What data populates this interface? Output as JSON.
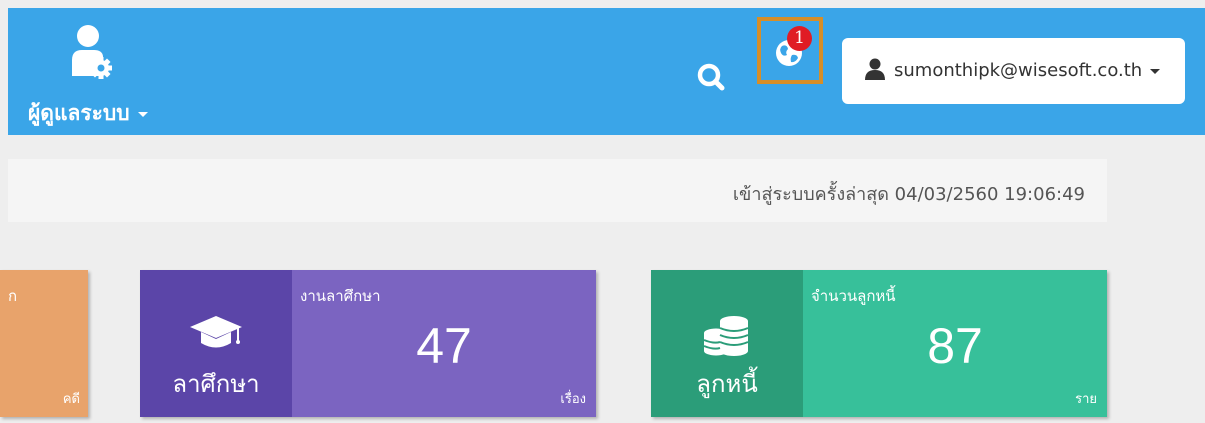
{
  "header": {
    "admin_label": "ผู้ดูแลระบบ",
    "admin_icon": "user-gear-icon",
    "search_icon": "search-icon",
    "notification": {
      "icon": "globe-icon",
      "badge_count": "1",
      "highlight_color": "#d78e27",
      "badge_color": "#e01c24"
    },
    "user": {
      "icon": "user-icon",
      "email": "sumonthipk@wisesoft.co.th"
    },
    "background_color": "#3aa5e8"
  },
  "info": {
    "last_login": "เข้าสู่ระบบครั้งล่าสุด 04/03/2560 19:06:49"
  },
  "cards": [
    {
      "partial_title": "ก",
      "partial_unit": "คดี",
      "color": "#e8a36b"
    },
    {
      "icon": "graduation-cap-icon",
      "icon_label": "ลาศึกษา",
      "title": "งานลาศึกษา",
      "value": "47",
      "unit": "เรื่อง",
      "icon_color": "#5b45a8",
      "data_color": "#7b64c1"
    },
    {
      "icon": "coins-icon",
      "icon_label": "ลูกหนี้",
      "title": "จำนวนลูกหนี้",
      "value": "87",
      "unit": "ราย",
      "icon_color": "#2b9d79",
      "data_color": "#37c09a"
    }
  ]
}
